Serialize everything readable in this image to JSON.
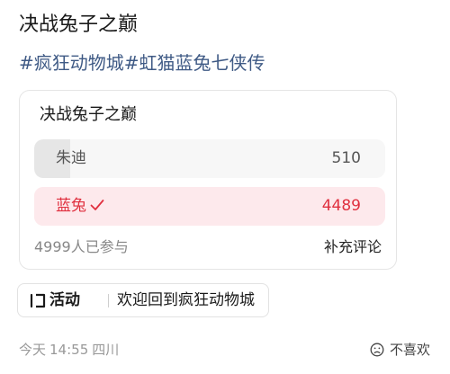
{
  "post": {
    "title": "决战兔子之巅",
    "hashtags": [
      "#疯狂动物城",
      "#虹猫蓝兔七侠传"
    ]
  },
  "poll": {
    "title": "决战兔子之巅",
    "options": [
      {
        "label": "朱迪",
        "count": "510",
        "share": 0.102,
        "selected": false
      },
      {
        "label": "蓝兔",
        "count": "4489",
        "share": 0.898,
        "selected": true
      }
    ],
    "participants": "4999人已参与",
    "add_comment": "补充评论",
    "selected_color": "#e0303f"
  },
  "activity": {
    "icon": "activity-icon",
    "label": "活动",
    "text": "欢迎回到疯狂动物城"
  },
  "meta": {
    "day": "今天",
    "time": "14:55",
    "location": "四川"
  },
  "reaction": {
    "icon": "frown-face-icon",
    "label": "不喜欢"
  }
}
